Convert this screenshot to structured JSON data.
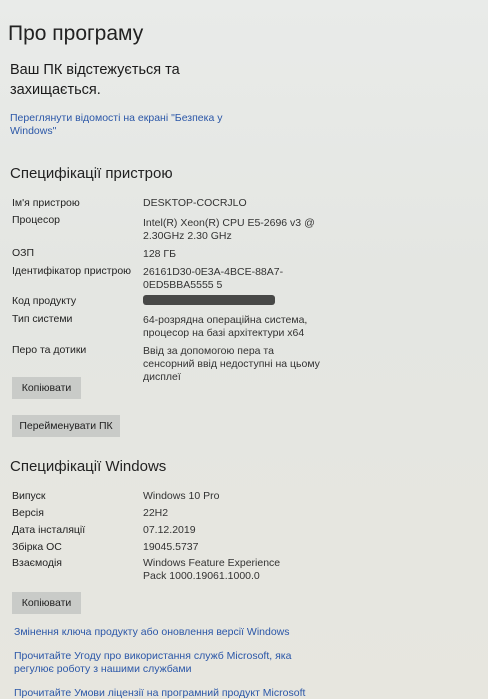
{
  "page": {
    "title": "Про програму",
    "protected_text": "Ваш ПК відстежується та захищається.",
    "security_link": "Переглянути відомості на екрані \"Безпека у Windows\""
  },
  "device_specs": {
    "heading": "Специфікації пристрою",
    "rows": [
      {
        "label": "Ім'я пристрою",
        "value": "DESKTOP-COCRJLO"
      },
      {
        "label": "Процесор",
        "value": "Intel(R) Xeon(R) CPU E5-2696 v3 @ 2.30GHz   2.30 GHz"
      },
      {
        "label": "ОЗП",
        "value": "128 ГБ"
      },
      {
        "label": "Ідентифікатор пристрою",
        "value": "26161D30-0E3A-4BCE-88A7-0ED5BBA5555 5"
      },
      {
        "label": "Код продукту",
        "value": ""
      },
      {
        "label": "Тип системи",
        "value": "64-розрядна операційна система, процесор на базі архітектури x64"
      },
      {
        "label": "Перо та дотики",
        "value": "Ввід за допомогою пера та сенсорний ввід недоступні на цьому дисплеї"
      }
    ],
    "copy_button": "Копіювати",
    "rename_button": "Перейменувати ПК"
  },
  "windows_specs": {
    "heading": "Специфікації Windows",
    "rows": [
      {
        "label": "Випуск",
        "value": "Windows 10 Pro"
      },
      {
        "label": "Версія",
        "value": "22H2"
      },
      {
        "label": "Дата інсталяції",
        "value": "07.12.2019"
      },
      {
        "label": "Збірка ОС",
        "value": "19045.5737"
      },
      {
        "label": "Взаємодія",
        "value": "Windows Feature Experience Pack 1000.19061.1000.0"
      }
    ],
    "copy_button": "Копіювати"
  },
  "links": {
    "change_key": "Змінення ключа продукту або оновлення версії Windows",
    "services_agreement": "Прочитайте Угоду про використання служб Microsoft, яка регулює роботу з нашими службами",
    "license_terms": "Прочитайте Умови ліцензії на програмний продукт Microsoft"
  },
  "colors": {
    "link": "#2b57a8",
    "button": "#c9cbc8"
  }
}
